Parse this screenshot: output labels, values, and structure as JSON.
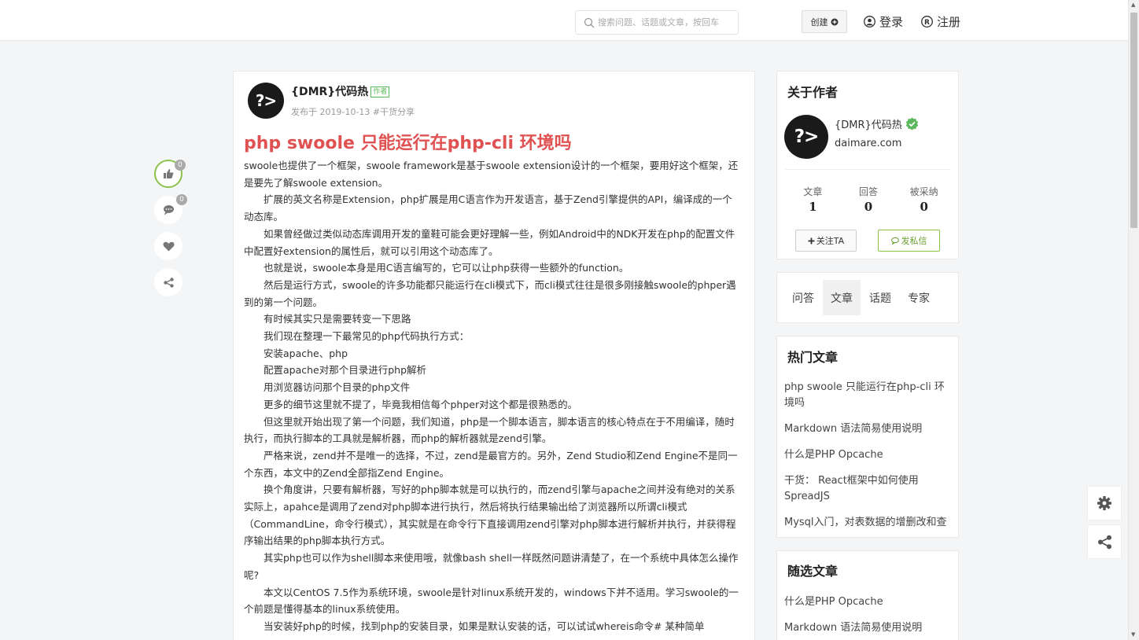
{
  "header": {
    "search_placeholder": "搜索问题、话题或文章，按回车",
    "create_label": "创建",
    "login_label": "登录",
    "register_label": "注册"
  },
  "float_actions": {
    "like_count": "0",
    "comment_count": "0"
  },
  "article": {
    "avatar_text": "?>",
    "author": "{DMR}代码热",
    "author_tag": "作者",
    "meta": "发布于 2019-10-13 #干货分享",
    "title": "php swoole 只能运行在php-cli 环境吗",
    "paragraphs": [
      "swoole也提供了一个框架，swoole framework是基于swoole extension设计的一个框架，要用好这个框架，还是要先了解swoole extension。",
      "扩展的英文名称是Extension，php扩展是用C语言作为开发语言，基于Zend引擎提供的API，编译成的一个动态库。",
      "如果曾经做过类似动态库调用开发的童鞋可能会更好理解一些，例如Android中的NDK开发在php的配置文件中配置好extension的属性后，就可以引用这个动态库了。",
      "也就是说，swoole本身是用C语言编写的，它可以让php获得一些额外的function。",
      "然后是运行方式，swoole的许多功能都只能运行在cli模式下，而cli模式往往是很多刚接触swoole的phper遇到的第一个问题。",
      "有时候其实只是需要转变一下思路",
      "我们现在整理一下最常见的php代码执行方式：",
      "安装apache、php",
      "配置apache对那个目录进行php解析",
      "用浏览器访问那个目录的php文件",
      "更多的细节这里就不提了，毕竟我相信每个phper对这个都是很熟悉的。",
      "但这里就开始出现了第一个问题，我们知道，php是一个脚本语言，脚本语言的核心特点在于不用编译，随时执行，而执行脚本的工具就是解析器，而php的解析器就是zend引擎。",
      "严格来说，zend并不是唯一的选择，不过，zend是最官方的。另外，Zend Studio和Zend Engine不是同一个东西，本文中的Zend全部指Zend Engine。",
      "换个角度讲，只要有解析器，写好的php脚本就是可以执行的，而zend引擎与apache之间并没有绝对的关系实际上，apahce是调用了zend对php脚本进行执行，然后将执行结果输出给了浏览器所以所谓cli模式（CommandLine，命令行模式），其实就是在命令行下直接调用zend引擎对php脚本进行解析并执行，并获得程序输出结果的php脚本执行方式。",
      "其实php也可以作为shell脚本来使用哦，就像bash shell一样既然问题讲清楚了，在一个系统中具体怎么操作呢?",
      "本文以CentOS 7.5作为系统环境，swoole是针对linux系统开发的，windows下并不适用。学习swoole的一个前题是懂得基本的linux系统使用。",
      "当安装好php的时候，找到php的安装目录，如果是默认安装的话，可以试试whereis命令# 某种简单"
    ]
  },
  "about": {
    "title": "关于作者",
    "avatar_text": "?>",
    "name": "{DMR}代码热",
    "site": "daimare.com",
    "stats": [
      {
        "label": "文章",
        "value": "1"
      },
      {
        "label": "回答",
        "value": "0"
      },
      {
        "label": "被采纳",
        "value": "0"
      }
    ],
    "follow_label": "关注TA",
    "message_label": "发私信"
  },
  "tabs": [
    "问答",
    "文章",
    "话题",
    "专家"
  ],
  "hot": {
    "title": "热门文章",
    "items": [
      "php swoole 只能运行在php-cli 环境吗",
      "Markdown 语法简易使用说明",
      "什么是PHP Opcache",
      "干货： React框架中如何使用SpreadJS",
      "Mysql入门，对表数据的增删改和查"
    ]
  },
  "random": {
    "title": "随选文章",
    "items": [
      "什么是PHP Opcache",
      "Markdown 语法简易使用说明"
    ]
  }
}
